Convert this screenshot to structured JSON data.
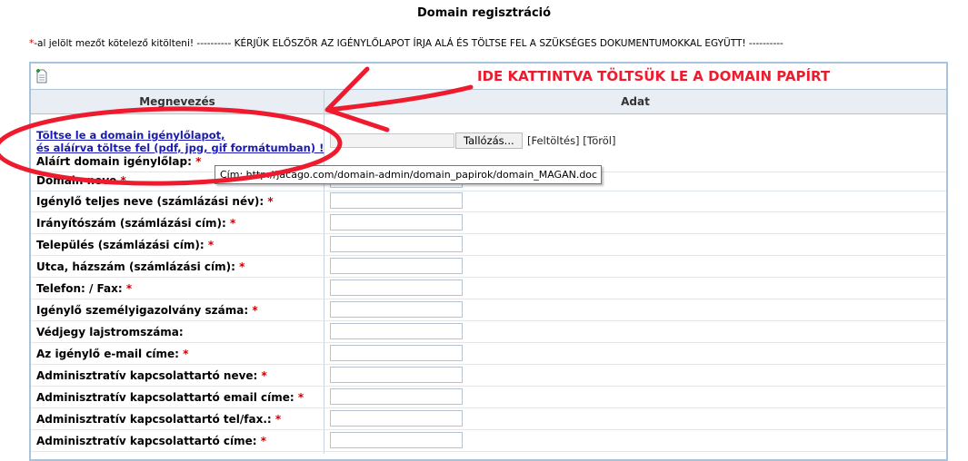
{
  "page": {
    "title": "Domain regisztráció",
    "notice_asterisk": "*",
    "notice_text": "-al jelölt mezőt kötelező kitölteni! ---------- KÉRJÜK ELŐSZÖR AZ IGÉNYLŐLAPOT ÍRJA ALÁ ÉS TÖLTSE FEL A SZÜKSÉGES DOKUMENTUMOKKAL EGYÜTT! ----------"
  },
  "annotation": {
    "text": "IDE KATTINTVA TÖLTSÜK LE A DOMAIN PAPÍRT",
    "color": "#ee1b2e"
  },
  "table": {
    "col_name": "Megnevezés",
    "col_value": "Adat",
    "download_link_line1": "Töltse le a domain igénylőlapot,",
    "download_link_line2": "és aláírva töltse fel (pdf, jpg, gif formátumban) !",
    "browse_button": "Tallózás...",
    "upload_link": "[Feltöltés]",
    "delete_link": "[Töröl]",
    "tooltip": "Cím: http://jacago.com/domain-admin/domain_papirok/domain_MAGAN.doc",
    "required_mark": "*",
    "fields": [
      {
        "label": "Aláírt domain igénylőlap:"
      },
      {
        "label": "Domain neve"
      },
      {
        "label": "Igénylő teljes neve (számlázási név):"
      },
      {
        "label": "Irányítószám (számlázási cím):"
      },
      {
        "label": "Település (számlázási cím):"
      },
      {
        "label": "Utca, házszám (számlázási cím):"
      },
      {
        "label": "Telefon: / Fax:"
      },
      {
        "label": "Igénylő személyigazolvány száma:"
      },
      {
        "label": "Védjegy lajstromszáma:"
      },
      {
        "label": "Az igénylő e-mail címe:"
      },
      {
        "label": "Adminisztratív kapcsolattartó neve:"
      },
      {
        "label": "Adminisztratív kapcsolattartó email címe:"
      },
      {
        "label": "Adminisztratív kapcsolattartó tel/fax.:"
      },
      {
        "label": "Adminisztratív kapcsolattartó címe:"
      }
    ]
  }
}
